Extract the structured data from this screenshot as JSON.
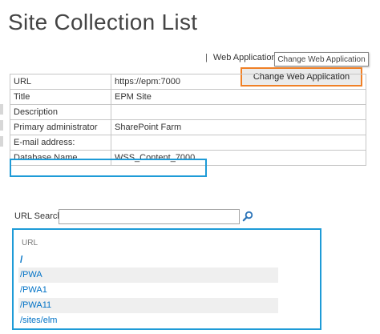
{
  "page": {
    "title": "Site Collection List"
  },
  "web_application": {
    "label": "Web Application:",
    "separator": "|",
    "selected": "Change Web Application",
    "menu_item": "Change Web Application"
  },
  "info": {
    "rows": [
      {
        "label": "URL",
        "value": "https://epm:7000"
      },
      {
        "label": "Title",
        "value": "EPM Site"
      },
      {
        "label": "Description",
        "value": ""
      },
      {
        "label": "Primary administrator",
        "value": "SharePoint Farm"
      },
      {
        "label": "E-mail address:",
        "value": ""
      },
      {
        "label": "Database Name",
        "value": "WSS_Content_7000"
      }
    ]
  },
  "search": {
    "label": "URL Search",
    "value": "",
    "icon": "search-icon"
  },
  "url_list": {
    "header": "URL",
    "items": [
      "/",
      "/PWA",
      "/PWA1",
      "/PWA11",
      "/sites/elm"
    ]
  },
  "colors": {
    "highlight_blue": "#1e9bd7",
    "highlight_orange": "#f08026",
    "link": "#0072c6"
  }
}
